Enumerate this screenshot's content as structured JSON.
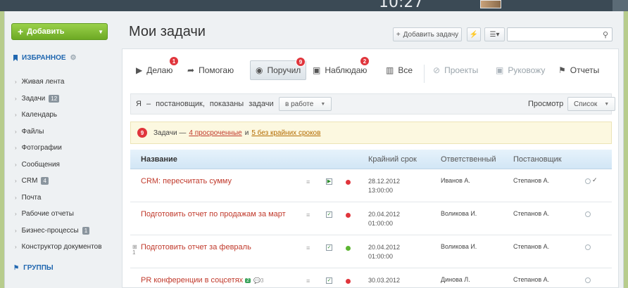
{
  "header": {
    "clock": "10:27"
  },
  "sidebar": {
    "add_label": "Добавить",
    "favorites_label": "ИЗБРАННОЕ",
    "groups_label": "ГРУППЫ",
    "items": [
      {
        "label": "Живая лента",
        "count": ""
      },
      {
        "label": "Задачи",
        "count": "12"
      },
      {
        "label": "Календарь",
        "count": ""
      },
      {
        "label": "Файлы",
        "count": ""
      },
      {
        "label": "Фотографии",
        "count": ""
      },
      {
        "label": "Сообщения",
        "count": ""
      },
      {
        "label": "CRM",
        "count": "4"
      },
      {
        "label": "Почта",
        "count": ""
      },
      {
        "label": "Рабочие отчеты",
        "count": ""
      },
      {
        "label": "Бизнес-процессы",
        "count": "1"
      },
      {
        "label": "Конструктор документов",
        "count": ""
      }
    ]
  },
  "main": {
    "title": "Мои задачи",
    "add_task_label": "Добавить задачу",
    "tabs": [
      {
        "label": "Делаю",
        "badge": "1"
      },
      {
        "label": "Помогаю",
        "badge": ""
      },
      {
        "label": "Поручил",
        "badge": "9"
      },
      {
        "label": "Наблюдаю",
        "badge": "2"
      },
      {
        "label": "Все",
        "badge": ""
      },
      {
        "label": "Проекты",
        "badge": ""
      },
      {
        "label": "Руковожу",
        "badge": ""
      },
      {
        "label": "Отчеты",
        "badge": ""
      }
    ],
    "filter": {
      "text": "Я – постановщик, показаны задачи",
      "status": "в работе",
      "view_label": "Просмотр",
      "view_value": "Список"
    },
    "notice": {
      "badge": "9",
      "prefix": "Задачи —",
      "overdue": "4 просроченные",
      "and": "и",
      "nodeadline": "5 без крайних сроков"
    },
    "columns": {
      "name": "Название",
      "deadline": "Крайний срок",
      "responsible": "Ответственный",
      "creator": "Постановщик"
    },
    "rows": [
      {
        "name": "CRM: пересчитать сумму",
        "date": "28.12.2012",
        "time": "13:00:00",
        "responsible": "Иванов А.",
        "creator": "Степанов А.",
        "status_color": "#e0353c"
      },
      {
        "name": "Подготовить отчет по продажам за март",
        "date": "20.04.2012",
        "time": "01:00:00",
        "responsible": "Воликова И.",
        "creator": "Степанов А.",
        "status_color": "#e0353c"
      },
      {
        "name": "Подготовить отчет за февраль",
        "date": "20.04.2012",
        "time": "01:00:00",
        "responsible": "Воликова И.",
        "creator": "Степанов А.",
        "status_color": "#5cb531"
      },
      {
        "name": "PR конференции в соцсетях",
        "date": "30.03.2012",
        "time": "",
        "responsible": "Динова Л.",
        "creator": "Степанов А.",
        "status_color": "#e0353c",
        "tag": "2",
        "comments": "3"
      }
    ]
  }
}
